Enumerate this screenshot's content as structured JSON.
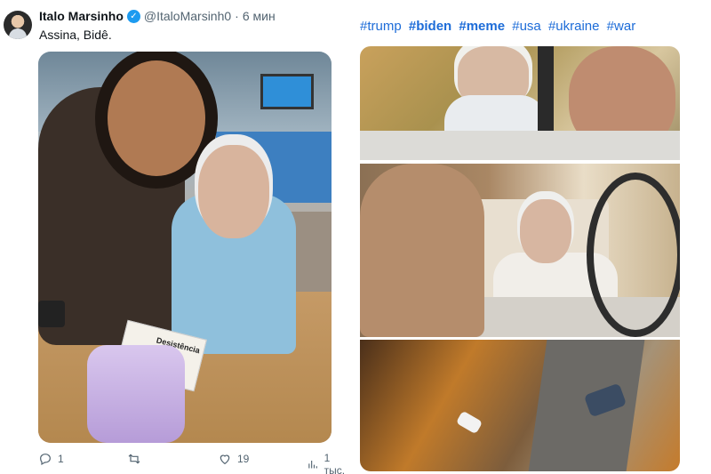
{
  "tweet": {
    "author_name": "Italo Marsinho",
    "handle": "@ItaloMarsinh0",
    "separator": "·",
    "time": "6 мин",
    "text": "Assina, Bidê.",
    "image_card_text": "Desistência",
    "actions": {
      "replies": "1",
      "retweets": "",
      "likes": "19",
      "views": "1 тыс."
    }
  },
  "right_post": {
    "hashtags": [
      "#trump",
      "#biden",
      "#meme",
      "#usa",
      "#ukraine",
      "#war"
    ]
  },
  "icons": {
    "verified": "verified-badge-icon",
    "reply": "reply-icon",
    "retweet": "retweet-icon",
    "like": "heart-icon",
    "views": "views-chart-icon"
  },
  "colors": {
    "link": "#1d6cd8",
    "verified": "#1d9bf0",
    "muted": "#536471"
  }
}
